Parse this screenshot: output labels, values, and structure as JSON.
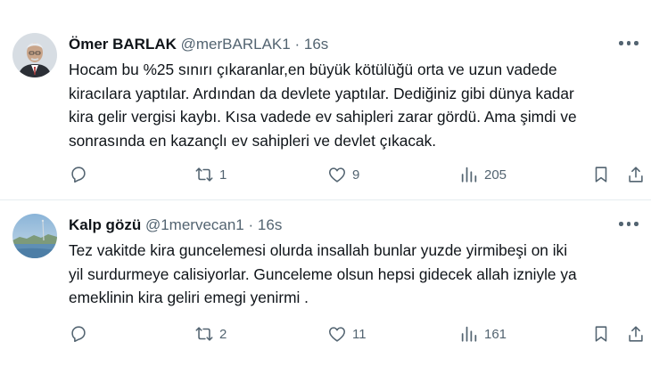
{
  "tweets": [
    {
      "author": {
        "name": "Ömer BARLAK",
        "handle": "@merBARLAK1",
        "sep": "·",
        "time": "16s"
      },
      "text": [
        "Hocam bu %25 sınırı çıkaranlar,en büyük kötülüğü orta ve uzun vadede",
        "kiracılara yaptılar. Ardından da devlete yaptılar. Dediğiniz gibi dünya kadar",
        "kira gelir vergisi kaybı. Kısa vadede ev sahipleri zarar gördü. Ama şimdi ve",
        "sonrasında en kazançlı ev sahipleri ve devlet çıkacak."
      ],
      "stats": {
        "replies": "",
        "retweets": "1",
        "likes": "9",
        "views": "205"
      }
    },
    {
      "author": {
        "name": "Kalp gözü",
        "handle": "@1mervecan1",
        "sep": "·",
        "time": "16s"
      },
      "text": [
        "Tez vakitde kira guncelemesi olurda insallah  bunlar yuzde yirmibeşi  on iki",
        "yil surdurmeye calisiyorlar.  Gunceleme olsun hepsi gidecek allah izniyle ya",
        "emeklinin kira geliri  emegi yenirmi ."
      ],
      "stats": {
        "replies": "",
        "retweets": "2",
        "likes": "11",
        "views": "161"
      }
    }
  ],
  "icons": [
    "more-icon",
    "reply-icon",
    "retweet-icon",
    "like-icon",
    "views-icon",
    "bookmark-icon",
    "share-icon"
  ],
  "colors": {
    "text": "#0f1419",
    "muted": "#536471",
    "divider": "#e6ecf0"
  }
}
